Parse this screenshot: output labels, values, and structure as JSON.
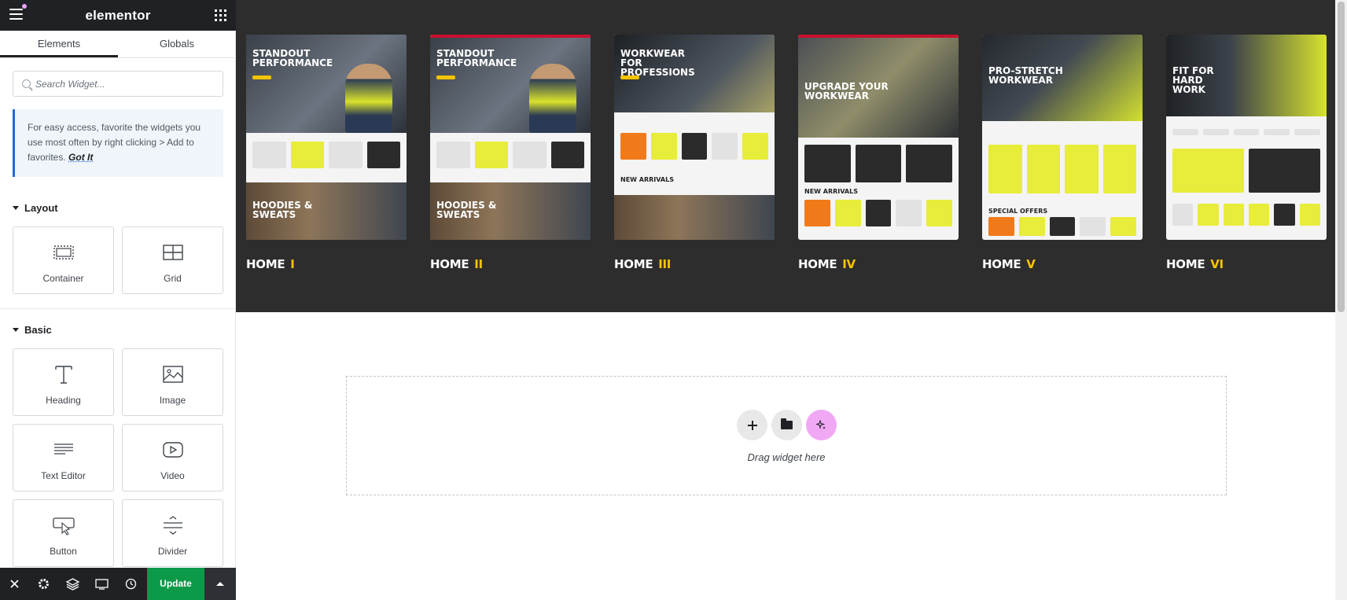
{
  "topbar": {
    "logo": "elementor"
  },
  "tabs": [
    {
      "label": "Elements",
      "active": true
    },
    {
      "label": "Globals",
      "active": false
    }
  ],
  "search": {
    "placeholder": "Search Widget..."
  },
  "tip": {
    "text": "For easy access, favorite the widgets you use most often by right clicking > Add to favorites.",
    "link": "Got It"
  },
  "sections": {
    "layout": {
      "title": "Layout",
      "widgets": [
        {
          "label": "Container",
          "icon": "container-icon"
        },
        {
          "label": "Grid",
          "icon": "grid-icon"
        }
      ]
    },
    "basic": {
      "title": "Basic",
      "widgets": [
        {
          "label": "Heading",
          "icon": "heading-icon"
        },
        {
          "label": "Image",
          "icon": "image-icon"
        },
        {
          "label": "Text Editor",
          "icon": "text-editor-icon"
        },
        {
          "label": "Video",
          "icon": "video-icon"
        },
        {
          "label": "Button",
          "icon": "button-icon"
        },
        {
          "label": "Divider",
          "icon": "divider-icon"
        }
      ]
    }
  },
  "bottombar": {
    "icons": [
      "close-icon",
      "settings-icon",
      "layers-icon",
      "responsive-icon",
      "history-icon"
    ],
    "update_label": "Update"
  },
  "demos": [
    {
      "label": "HOME",
      "numeral": "I",
      "hero": "STANDOUT PERFORMANCE",
      "footer": "HOODIES & SWEATS"
    },
    {
      "label": "HOME",
      "numeral": "II",
      "hero": "STANDOUT PERFORMANCE",
      "footer": "HOODIES & SWEATS"
    },
    {
      "label": "HOME",
      "numeral": "III",
      "hero": "WORKWEAR FOR PROFESSIONS",
      "footer": "NEW ARRIVALS"
    },
    {
      "label": "HOME",
      "numeral": "IV",
      "hero": "UPGRADE YOUR WORKWEAR",
      "footer": "NEW ARRIVALS"
    },
    {
      "label": "HOME",
      "numeral": "V",
      "hero": "PRO-STRETCH WORKWEAR",
      "footer": "SPECIAL OFFERS"
    },
    {
      "label": "HOME",
      "numeral": "VI",
      "hero": "FIT FOR HARD WORK",
      "footer": ""
    }
  ],
  "dropzone": {
    "text": "Drag widget here"
  },
  "colors": {
    "accent_yellow": "#f5c400",
    "update_green": "#0c9a49",
    "tip_border": "#2469d8",
    "dark_bg": "#2d2d2d",
    "ai_pink": "#f0a8f5"
  }
}
